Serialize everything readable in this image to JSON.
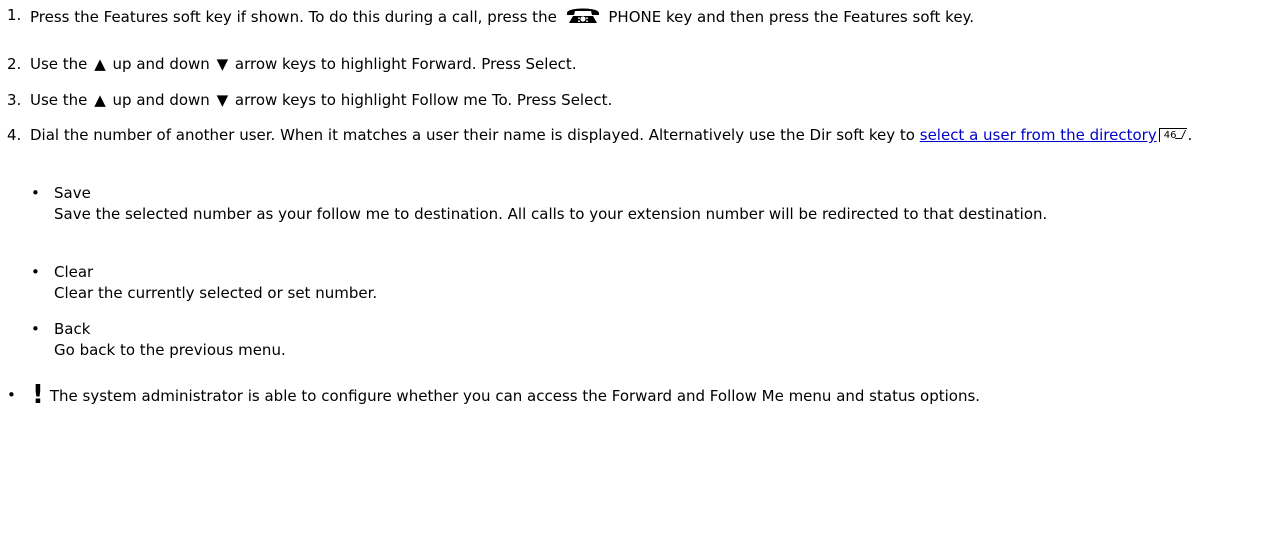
{
  "steps": [
    {
      "num": "1.",
      "pre": "Press the Features soft key if shown. To do this during a call, press the",
      "key_label": "PHONE key and then press the Features soft key."
    },
    {
      "num": "2.",
      "pre": "Use the",
      "mid": "up and down",
      "post": "arrow keys to highlight Forward. Press Select."
    },
    {
      "num": "3.",
      "pre": "Use the",
      "mid": "up and down",
      "post": "arrow keys to highlight Follow me To. Press Select."
    },
    {
      "num": "4.",
      "pre": "Dial the number of another user. When it matches a user their name is displayed. Alternatively use the Dir soft key to",
      "link": "select a user from the directory",
      "pageref": "46",
      "post": "."
    }
  ],
  "options": [
    {
      "title": "Save",
      "desc": "Save the selected number as your follow me to destination. All calls to your extension number will be redirected to that destination."
    },
    {
      "title": "Clear",
      "desc": "Clear the currently selected or set number."
    },
    {
      "title": "Back",
      "desc": "Go back to the previous menu."
    }
  ],
  "note": {
    "mark": "!",
    "text": "The system administrator is able to configure whether you can access the Forward and Follow Me menu and status options."
  },
  "glyphs": {
    "up": "▲",
    "down": "▼",
    "bullet": "•"
  },
  "icons": {
    "phone": "phone-icon",
    "pageref": "page-reference-icon"
  }
}
